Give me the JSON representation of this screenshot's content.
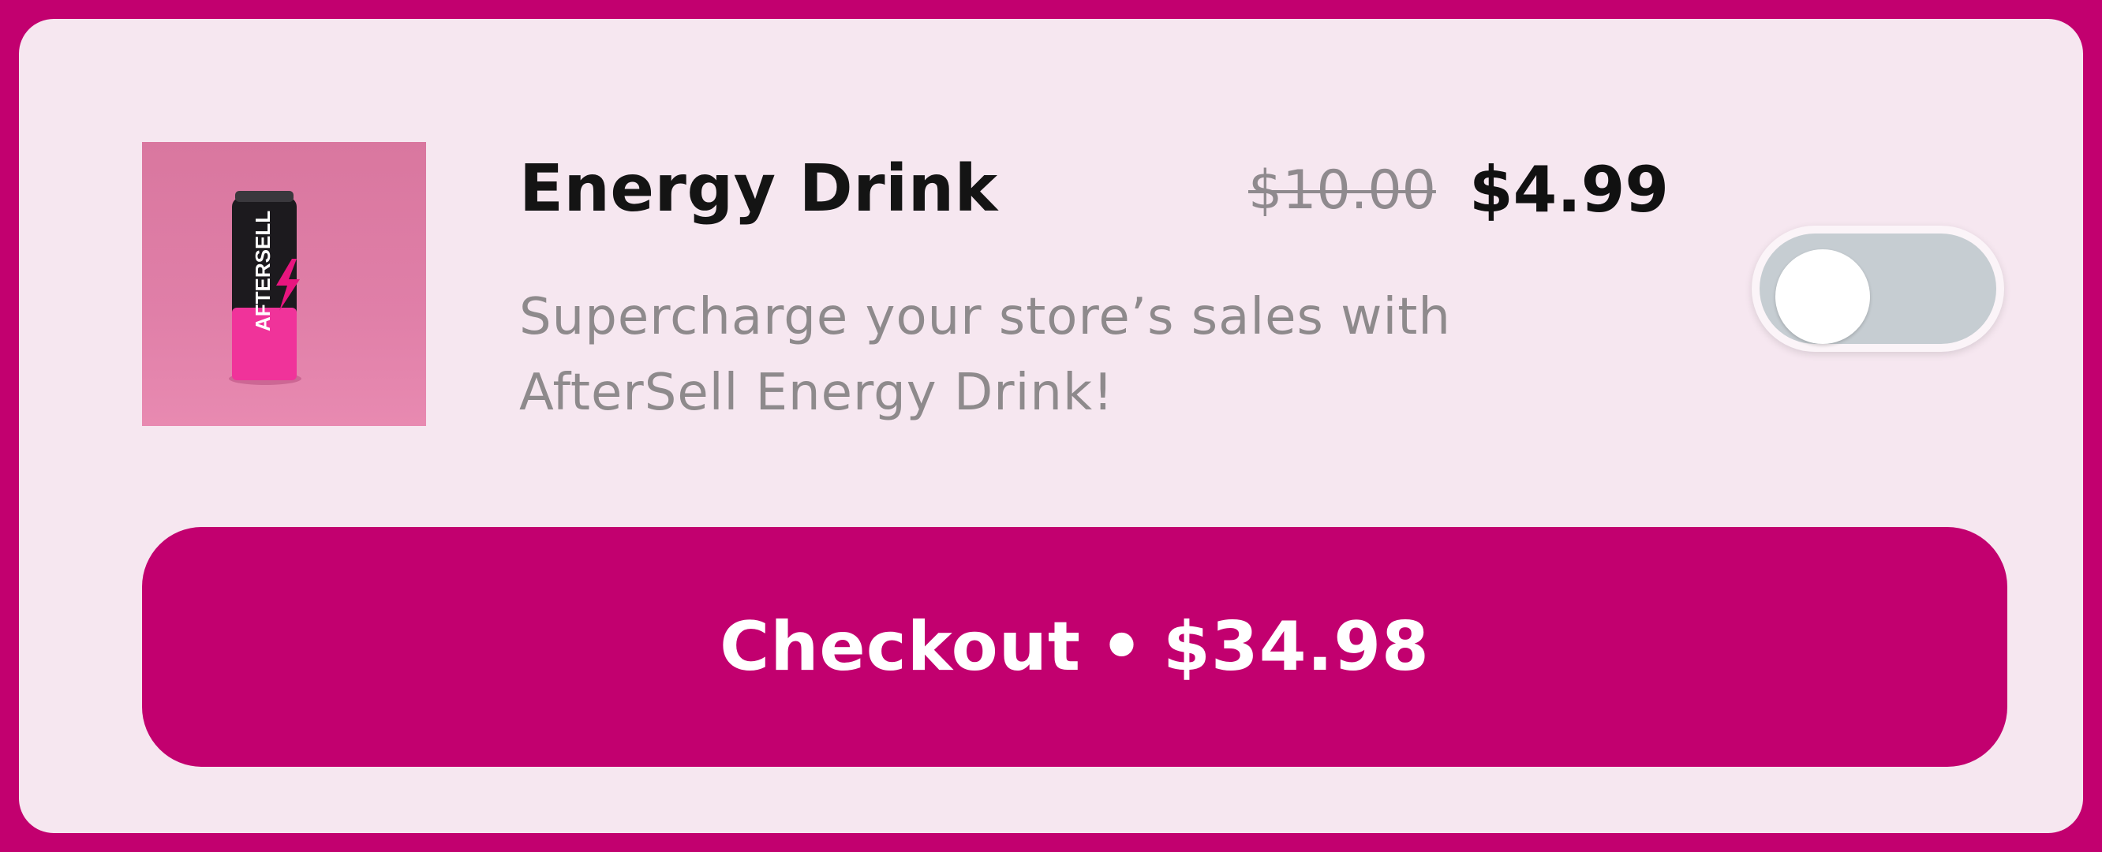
{
  "colors": {
    "frame": "#C2006F",
    "card_background": "#F6E7F0",
    "button_background": "#C2006F",
    "button_text": "#FFFFFF",
    "title_text": "#141414",
    "muted_text": "#8E8A8C",
    "toggle_track": "#C6CDD2"
  },
  "product": {
    "image_icon": "energy-drink-can-image",
    "can_brand_text": "AFTERSELL",
    "title": "Energy Drink",
    "original_price": "$10.00",
    "sale_price": "$4.99",
    "description": "Supercharge your store’s sales with AfterSell Energy Drink!",
    "toggle_on": false
  },
  "checkout": {
    "label": "Checkout",
    "separator": "•",
    "total": "$34.98"
  }
}
